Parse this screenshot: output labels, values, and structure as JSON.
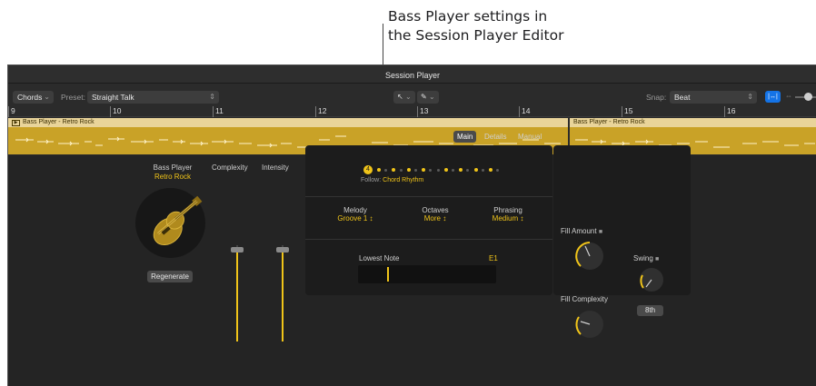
{
  "callout": {
    "line1": "Bass Player settings in",
    "line2": "the Session Player Editor"
  },
  "window": {
    "title": "Session Player"
  },
  "toolbar": {
    "view_select": "Chords",
    "preset_label": "Preset:",
    "preset_value": "Straight Talk",
    "pointer_tool": "↖",
    "pencil_tool": "✎",
    "snap_label": "Snap:",
    "snap_value": "Beat"
  },
  "ruler": {
    "bars": [
      "9",
      "10",
      "11",
      "12",
      "13",
      "14",
      "15",
      "16"
    ]
  },
  "regions": [
    {
      "label": "Bass Player - Retro Rock"
    },
    {
      "label": "Bass Player - Retro Rock"
    }
  ],
  "tabs": {
    "main": "Main",
    "details": "Details",
    "manual": "Manual"
  },
  "player": {
    "name": "Bass Player",
    "style": "Retro Rock",
    "regenerate": "Regenerate"
  },
  "sliders": {
    "complexity_label": "Complexity",
    "intensity_label": "Intensity",
    "complexity_level": 0.95,
    "intensity_level": 0.95
  },
  "beats": {
    "count": "4",
    "follow_label": "Follow:",
    "follow_value": "Chord Rhythm",
    "pattern": [
      1,
      0,
      1,
      0,
      1,
      0,
      1,
      0,
      0,
      1,
      0,
      1,
      0,
      1,
      0,
      1,
      0
    ]
  },
  "main_controls": {
    "melody_label": "Melody",
    "melody_value": "Groove 1 ↕",
    "octaves_label": "Octaves",
    "octaves_value": "More ↕",
    "phrasing_label": "Phrasing",
    "phrasing_value": "Medium ↕"
  },
  "lowest_note": {
    "label": "Lowest Note",
    "value": "E1"
  },
  "knobs": {
    "fill_amount_label": "Fill Amount",
    "fill_complexity_label": "Fill Complexity",
    "swing_label": "Swing",
    "swing_value": "8th",
    "lock_icon": "🔒"
  },
  "colors": {
    "accent": "#f0c419",
    "region": "#c9a227",
    "region_header": "#e9d49a",
    "background": "#242424",
    "panel": "#1c1c1c"
  }
}
